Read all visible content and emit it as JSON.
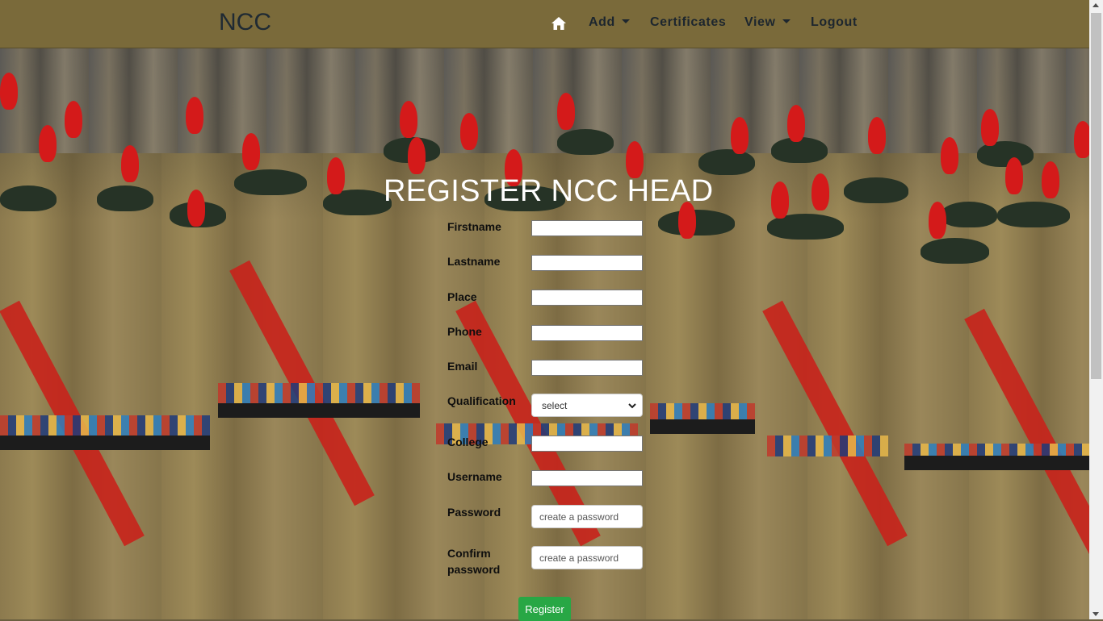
{
  "navbar": {
    "brand": "NCC",
    "items": [
      {
        "label": "Add"
      },
      {
        "label": "Certificates"
      },
      {
        "label": "View"
      },
      {
        "label": "Logout"
      }
    ]
  },
  "form": {
    "title": "REGISTER NCC HEAD",
    "fields": {
      "firstname": {
        "label": "Firstname",
        "value": ""
      },
      "lastname": {
        "label": "Lastname",
        "value": ""
      },
      "place": {
        "label": "Place",
        "value": ""
      },
      "phone": {
        "label": "Phone",
        "value": ""
      },
      "email": {
        "label": "Email",
        "value": ""
      },
      "qualification": {
        "label": "Qualification",
        "selected": "select"
      },
      "college": {
        "label": "College",
        "value": ""
      },
      "username": {
        "label": "Username",
        "value": ""
      },
      "password": {
        "label": "Password",
        "placeholder": "create a password"
      },
      "confirm_password": {
        "label_line1": "Confirm",
        "label_line2": "password",
        "placeholder": "create a password"
      }
    },
    "submit_label": "Register"
  },
  "colors": {
    "navbar_bg": "#7a6a3a",
    "submit_bg": "#28a745"
  },
  "icons": {
    "home": "home-icon",
    "caret": "chevron-down-icon"
  }
}
